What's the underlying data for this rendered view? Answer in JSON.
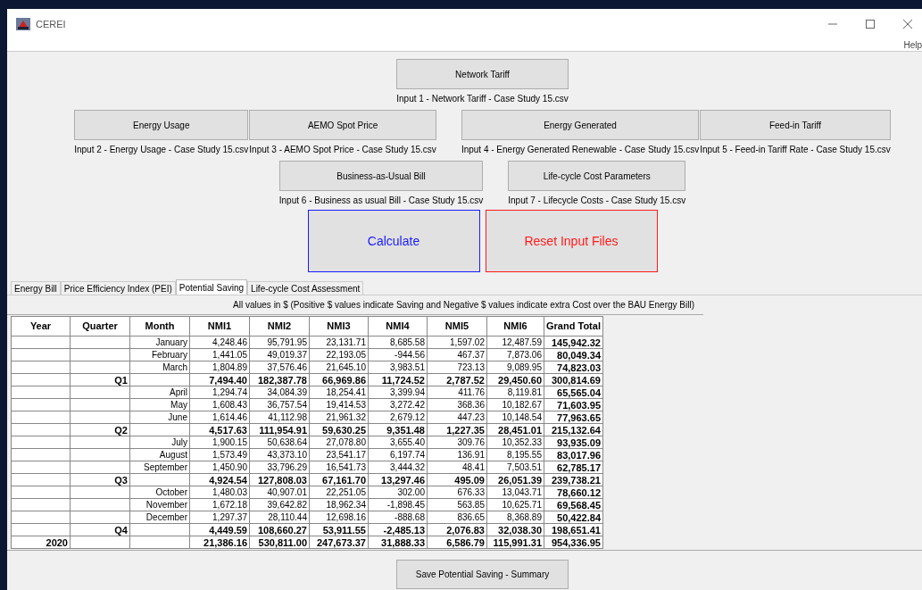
{
  "window": {
    "title": "CEREI"
  },
  "menu": [
    "Help"
  ],
  "input_rows": [
    [
      [
        {
          "label": "Network Tariff",
          "caption": "Input 1 - Network Tariff - Case Study 15.csv"
        }
      ]
    ],
    [
      [
        {
          "label": "Energy Usage",
          "caption": "Input 2 - Energy Usage - Case Study 15.csv"
        },
        {
          "label": "AEMO Spot Price",
          "caption": "Input 3 - AEMO Spot Price - Case Study 15.csv"
        }
      ],
      [
        {
          "label": "Energy Generated",
          "caption": "Input 4 - Energy Generated Renewable - Case Study 15.csv"
        },
        {
          "label": "Feed-in Tariff",
          "caption": "Input 5 - Feed-in Tariff Rate - Case Study 15.csv"
        }
      ]
    ],
    [
      [
        {
          "label": "Business-as-Usual Bill",
          "caption": "Input 6 - Business as usual Bill - Case Study 15.csv"
        }
      ],
      [
        {
          "label": "Life-cycle Cost Parameters",
          "caption": "Input 7 - Lifecycle Costs  - Case Study 15.csv"
        }
      ]
    ]
  ],
  "action_buttons": [
    {
      "label": "Calculate",
      "color": "#1a1aff"
    },
    {
      "label": "Reset Input Files",
      "color": "#ff1a1a"
    }
  ],
  "tabs": [
    {
      "label": "Energy Bill",
      "selected": false
    },
    {
      "label": "Price Efficiency Index (PEI)",
      "selected": false
    },
    {
      "label": "Potential Saving",
      "selected": true
    },
    {
      "label": "Life-cycle Cost Assessment",
      "selected": false
    }
  ],
  "note": "All values in $ (Positive $ values indicate Saving and Negative $ values indicate extra Cost over the BAU Energy Bill)",
  "table": {
    "columns": [
      "Year",
      "Quarter",
      "Month",
      "NMI1",
      "NMI2",
      "NMI3",
      "NMI4",
      "NMI5",
      "NMI6",
      "Grand Total"
    ],
    "rows": [
      {
        "kind": "month",
        "label": "January",
        "values": [
          "4,248.46",
          "95,791.95",
          "23,131.71",
          "8,685.58",
          "1,597.02",
          "12,487.59",
          "145,942.32"
        ]
      },
      {
        "kind": "month",
        "label": "February",
        "values": [
          "1,441.05",
          "49,019.37",
          "22,193.05",
          "-944.56",
          "467.37",
          "7,873.06",
          "80,049.34"
        ]
      },
      {
        "kind": "month",
        "label": "March",
        "values": [
          "1,804.89",
          "37,576.46",
          "21,645.10",
          "3,983.51",
          "723.13",
          "9,089.95",
          "74,823.03"
        ]
      },
      {
        "kind": "quarter",
        "label": "Q1",
        "values": [
          "7,494.40",
          "182,387.78",
          "66,969.86",
          "11,724.52",
          "2,787.52",
          "29,450.60",
          "300,814.69"
        ]
      },
      {
        "kind": "month",
        "label": "April",
        "values": [
          "1,294.74",
          "34,084.39",
          "18,254.41",
          "3,399.94",
          "411.76",
          "8,119.81",
          "65,565.04"
        ]
      },
      {
        "kind": "month",
        "label": "May",
        "values": [
          "1,608.43",
          "36,757.54",
          "19,414.53",
          "3,272.42",
          "368.36",
          "10,182.67",
          "71,603.95"
        ]
      },
      {
        "kind": "month",
        "label": "June",
        "values": [
          "1,614.46",
          "41,112.98",
          "21,961.32",
          "2,679.12",
          "447.23",
          "10,148.54",
          "77,963.65"
        ]
      },
      {
        "kind": "quarter",
        "label": "Q2",
        "values": [
          "4,517.63",
          "111,954.91",
          "59,630.25",
          "9,351.48",
          "1,227.35",
          "28,451.01",
          "215,132.64"
        ]
      },
      {
        "kind": "month",
        "label": "July",
        "values": [
          "1,900.15",
          "50,638.64",
          "27,078.80",
          "3,655.40",
          "309.76",
          "10,352.33",
          "93,935.09"
        ]
      },
      {
        "kind": "month",
        "label": "August",
        "values": [
          "1,573.49",
          "43,373.10",
          "23,541.17",
          "6,197.74",
          "136.91",
          "8,195.55",
          "83,017.96"
        ]
      },
      {
        "kind": "month",
        "label": "September",
        "values": [
          "1,450.90",
          "33,796.29",
          "16,541.73",
          "3,444.32",
          "48.41",
          "7,503.51",
          "62,785.17"
        ]
      },
      {
        "kind": "quarter",
        "label": "Q3",
        "values": [
          "4,924.54",
          "127,808.03",
          "67,161.70",
          "13,297.46",
          "495.09",
          "26,051.39",
          "239,738.21"
        ]
      },
      {
        "kind": "month",
        "label": "October",
        "values": [
          "1,480.03",
          "40,907.01",
          "22,251.05",
          "302.00",
          "676.33",
          "13,043.71",
          "78,660.12"
        ]
      },
      {
        "kind": "month",
        "label": "November",
        "values": [
          "1,672.18",
          "39,642.82",
          "18,962.34",
          "-1,898.45",
          "563.85",
          "10,625.71",
          "69,568.45"
        ]
      },
      {
        "kind": "month",
        "label": "December",
        "values": [
          "1,297.37",
          "28,110.44",
          "12,698.16",
          "-888.68",
          "836.65",
          "8,368.89",
          "50,422.84"
        ]
      },
      {
        "kind": "quarter",
        "label": "Q4",
        "values": [
          "4,449.59",
          "108,660.27",
          "53,911.55",
          "-2,485.13",
          "2,076.83",
          "32,038.30",
          "198,651.41"
        ]
      },
      {
        "kind": "year",
        "label": "2020",
        "values": [
          "21,386.16",
          "530,811.00",
          "247,673.37",
          "31,888.33",
          "6,586.79",
          "115,991.31",
          "954,336.95"
        ]
      }
    ]
  },
  "save_button": "Save Potential Saving - Summary"
}
